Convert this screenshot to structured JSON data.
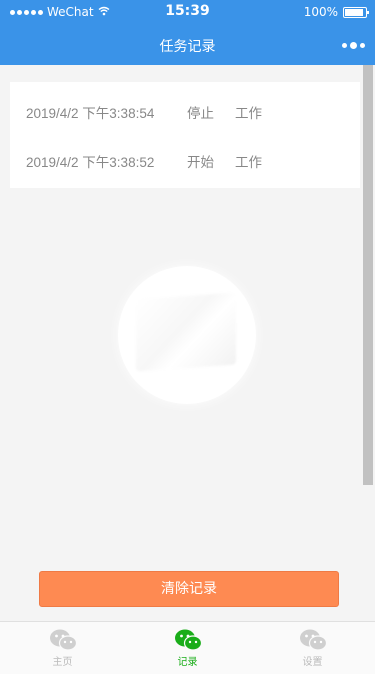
{
  "status_bar": {
    "carrier": "WeChat",
    "time": "15:39",
    "battery": "100%",
    "battery_level": 1.0
  },
  "nav": {
    "title": "任务记录",
    "more_icon": "more-dots-icon"
  },
  "records": [
    {
      "time": "2019/4/2 下午3:38:54",
      "action": "停止",
      "type": "工作"
    },
    {
      "time": "2019/4/2 下午3:38:52",
      "action": "开始",
      "type": "工作"
    }
  ],
  "clear_button": {
    "label": "清除记录"
  },
  "tabs": [
    {
      "label": "主页",
      "icon": "wechat-chat-icon",
      "active": false
    },
    {
      "label": "记录",
      "icon": "wechat-chat-icon",
      "active": true
    },
    {
      "label": "设置",
      "icon": "wechat-chat-icon",
      "active": false
    }
  ],
  "colors": {
    "nav_bg": "#3a93e8",
    "button_bg": "#fe8a52",
    "tab_active": "#1aad19",
    "tab_inactive": "#bbbbbb",
    "page_bg": "#f4f4f4"
  }
}
